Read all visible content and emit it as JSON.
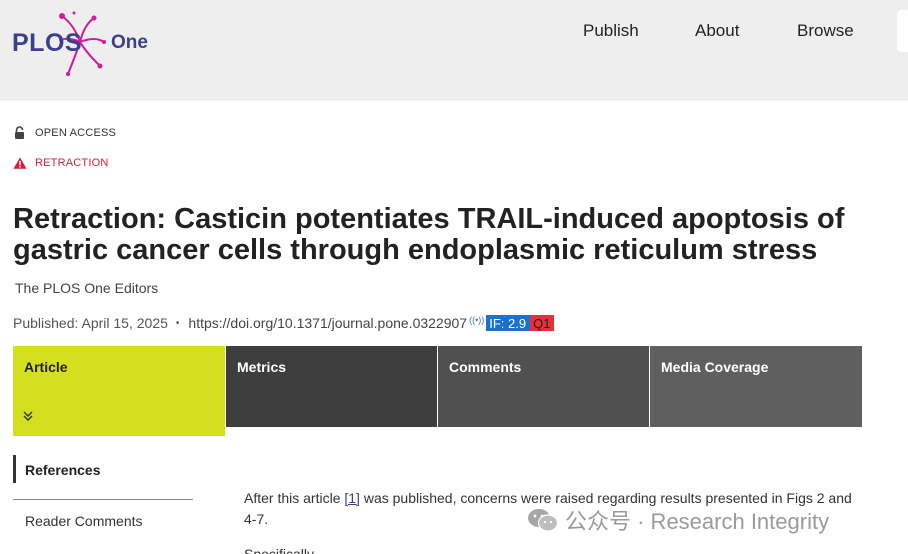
{
  "brand": {
    "name": "PLOS",
    "sub": "One",
    "color": "#3c3f8c",
    "accent": "#d11a9e"
  },
  "nav": {
    "publish": "Publish",
    "about": "About",
    "browse": "Browse"
  },
  "badges": {
    "open_access": {
      "label": "OPEN ACCESS",
      "icon": "unlock-icon"
    },
    "retraction": {
      "label": "RETRACTION",
      "icon": "warning-triangle-icon",
      "color": "#d2213c"
    }
  },
  "article": {
    "title": "Retraction: Casticin potentiates TRAIL-induced apoptosis of gastric cancer cells through endoplasmic reticulum stress",
    "authors": "The PLOS One Editors",
    "published": "Published: April 15, 2025",
    "separator": "•",
    "doi": "https://doi.org/10.1371/journal.pone.0322907",
    "impact_factor": "IF: 2.9",
    "quartile": "Q1"
  },
  "tabs": {
    "article": "Article",
    "metrics": "Metrics",
    "comments": "Comments",
    "media": "Media Coverage",
    "chevron": "»"
  },
  "sidenav": {
    "references": "References",
    "reader_comments": "Reader Comments"
  },
  "body": {
    "p1_before": "After this article ",
    "p1_ref": "[1]",
    "p1_after": " was published, concerns were raised regarding results presented in Figs 2 and 4-7.",
    "p2_partial": "Specifically"
  },
  "watermark": {
    "text": "公众号 · Research Integrity"
  }
}
